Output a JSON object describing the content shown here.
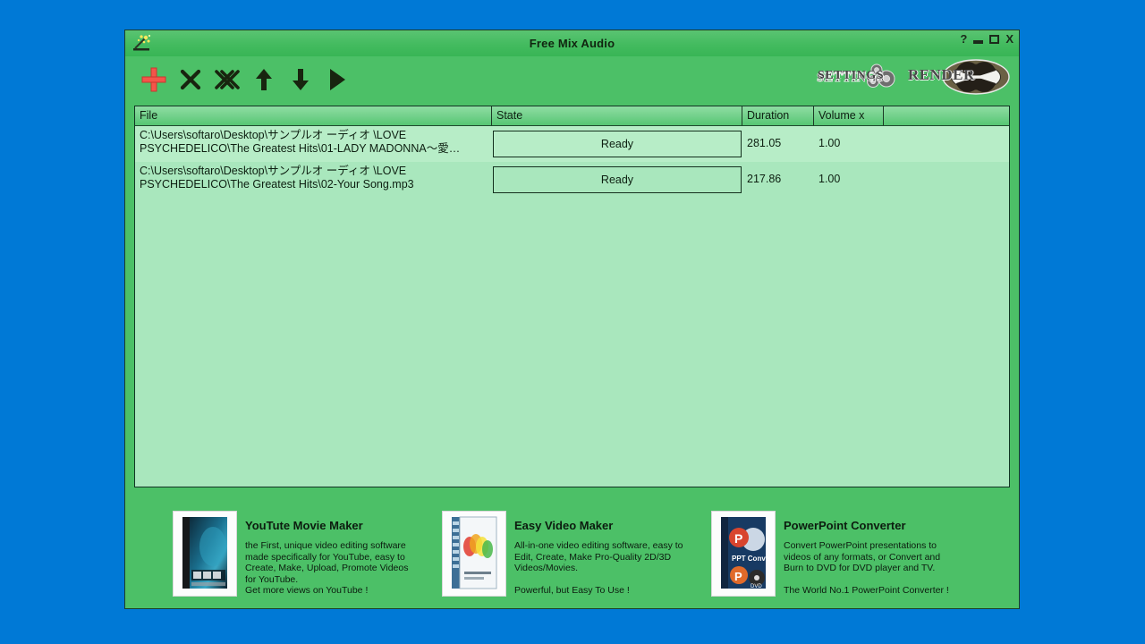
{
  "window": {
    "title": "Free Mix Audio",
    "app_icon": "sparkle-wand-icon",
    "controls": {
      "help": "?",
      "minimize": "minimize-icon",
      "maximize": "maximize-icon",
      "close": "X"
    }
  },
  "toolbar": {
    "tools": [
      {
        "name": "add-file-button",
        "icon": "plus-icon",
        "color": "#f4554a"
      },
      {
        "name": "remove-file-button",
        "icon": "close-x-icon",
        "color": "#18240f"
      },
      {
        "name": "remove-all-button",
        "icon": "double-x-icon",
        "color": "#18240f"
      },
      {
        "name": "move-up-button",
        "icon": "arrow-up-icon",
        "color": "#18240f"
      },
      {
        "name": "move-down-button",
        "icon": "arrow-down-icon",
        "color": "#18240f"
      },
      {
        "name": "play-button",
        "icon": "play-triangle-icon",
        "color": "#18240f"
      }
    ],
    "settings_label": "SETTINGS",
    "render_label": "RENDER"
  },
  "list": {
    "columns": [
      "File",
      "State",
      "Duration",
      "Volume x"
    ],
    "rows": [
      {
        "file": "C:\\Users\\softaro\\Desktop\\サンプルオ ーディオ \\LOVE\nPSYCHEDELICO\\The  Greatest  Hits\\01-LADY  MADONNA〜愛…",
        "state": "Ready",
        "duration": "281.05",
        "volume": "1.00",
        "selected": true
      },
      {
        "file": "C:\\Users\\softaro\\Desktop\\サンプルオ ーディオ \\LOVE\nPSYCHEDELICO\\The Greatest Hits\\02-Your Song.mp3",
        "state": "Ready",
        "duration": "217.86",
        "volume": "1.00",
        "selected": false
      }
    ]
  },
  "ads": [
    {
      "title": "YouTute Movie Maker",
      "desc": "the First, unique video editing software\nmade specifically for YouTube, easy to\nCreate, Make, Upload, Promote Videos\nfor YouTube.\nGet more views on YouTube !",
      "box_icon": "youtube-movie-maker-box"
    },
    {
      "title": "Easy Video Maker",
      "desc": "All-in-one video editing software, easy to\nEdit, Create, Make Pro-Quality 2D/3D\nVideos/Movies.\n\nPowerful, but Easy To Use !",
      "box_icon": "easy-video-maker-box"
    },
    {
      "title": "PowerPoint Converter",
      "desc": "Convert PowerPoint presentations to\nvideos of any formats, or Convert and\nBurn to DVD for DVD player and TV.\n\nThe World No.1 PowerPoint Converter !",
      "box_icon": "powerpoint-converter-box"
    }
  ],
  "colors": {
    "desktop": "#0079d6",
    "window": "#4cc067",
    "list_bg": "#a9e7bd",
    "selection": "#b7edc7",
    "accent_red": "#f4554a"
  }
}
